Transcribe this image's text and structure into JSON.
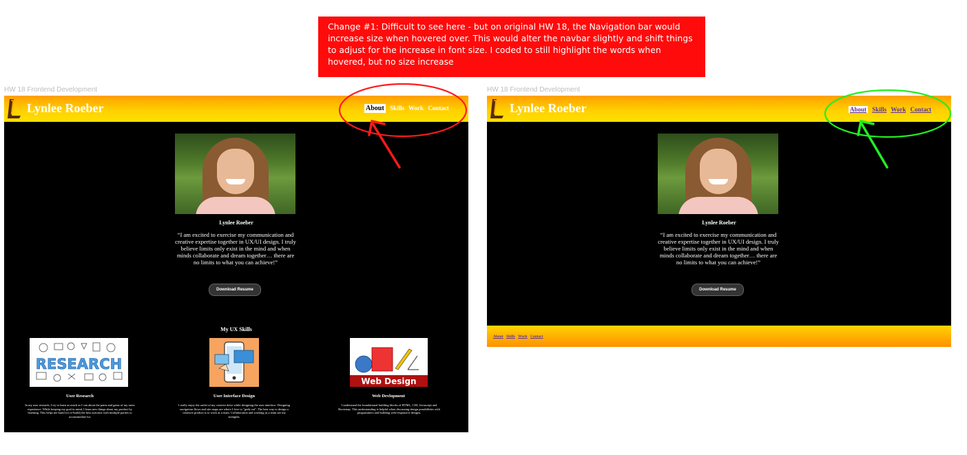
{
  "annotation": {
    "text": "Change #1: Difficult to see here - but on original HW 18, the Navigation bar would increase size when hovered over. This would alter the navbar slightly and shift things to adjust for the increase in font size. I coded to still highlight the words when hovered, but no size increase"
  },
  "frames": {
    "left_title": "HW 18 Frontend Development",
    "right_title": "HW 18 Frontend Development"
  },
  "site": {
    "brand": "Lynlee Roeber",
    "nav": [
      "About",
      "Skills",
      "Work",
      "Contact"
    ],
    "person_name": "Lynlee Roeber",
    "quote": "“I am excited to exercise my communication and creative expertise together in UX/UI design. I truly believe limits only exist in the mind and when minds collaborate and dream together… there are no limits to what you can achieve!”",
    "resume_button": "Download Resume",
    "skills_heading": "My UX Skills",
    "skills": [
      {
        "image_text": "RESEARCH",
        "title": "User Research",
        "desc": "In my user research, I try to learn as much as I can about the pains and gains of my users experience. While keeping my goal in mind, I learn new things about my product by listening. This helps me build (or re-build) the best outcome with multiple parties to accommodate for."
      },
      {
        "image_text": "",
        "title": "User Interface Design",
        "desc": "I really enjoy the outlet of my creative drive while designing the user interface. Designing navigation flows and site maps are where I love to \"geek out\". The best way to design a cohesive product is to work as a team. Collaboration and working as a team are my strengths."
      },
      {
        "image_text": "Web Design",
        "title": "Web Devlopment",
        "desc": "I understand the foundational building blocks of HTML, CSS, Javascript and Bootstrap. This understanding is helpful when discussing design possibilities with programmers and building web-responsive designs."
      }
    ],
    "footer_nav": [
      "About",
      "Skills",
      "Work",
      "Contact"
    ]
  },
  "colors": {
    "annotation_bg": "#ff0b0b",
    "left_highlight": "#ff1a1a",
    "right_highlight": "#22ee22",
    "navbar_start": "#ff9e00",
    "navbar_end": "#ffe000",
    "link_visited": "#5b2fa0"
  },
  "icons": [
    "logo-l-icon",
    "arrow-icon",
    "research-doodle-icon",
    "smartphone-ui-icon",
    "web-design-tools-icon"
  ]
}
